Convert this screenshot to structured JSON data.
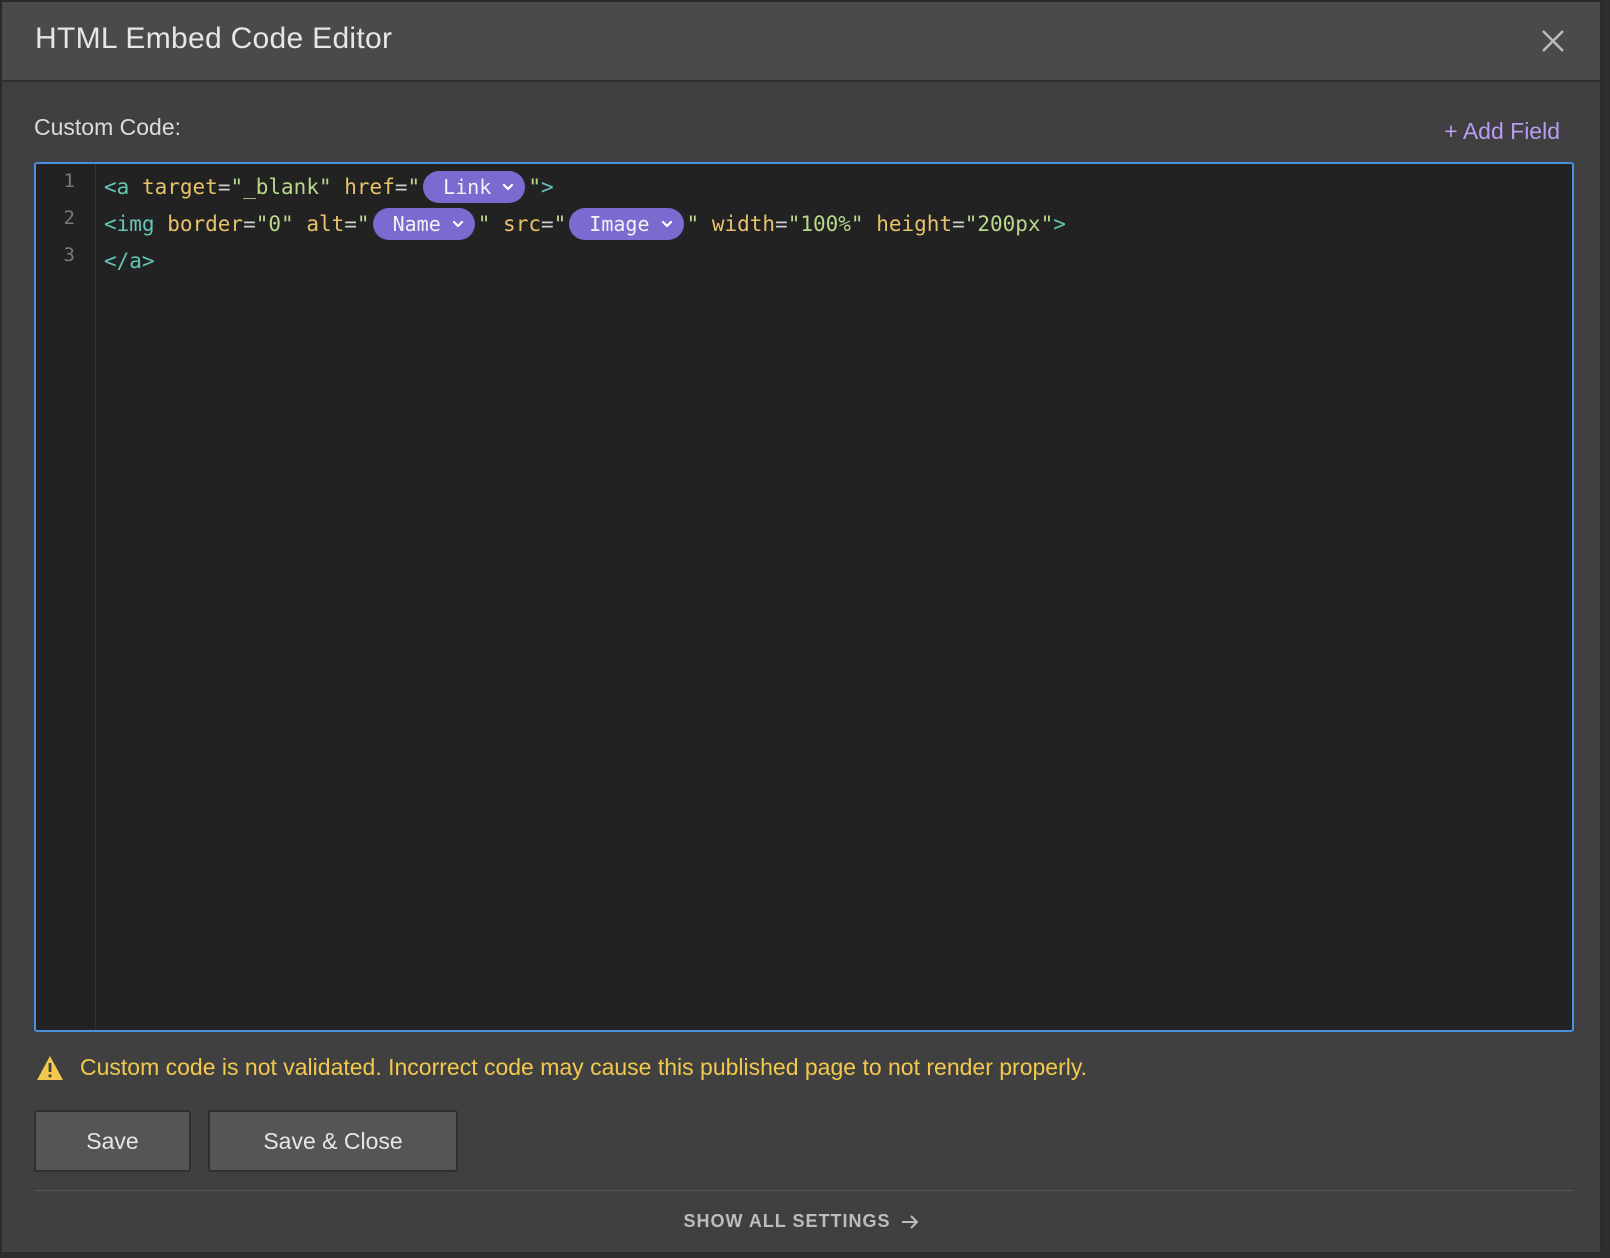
{
  "dialog": {
    "title": "HTML Embed Code Editor",
    "close_icon": "close-icon"
  },
  "custom_code": {
    "label": "Custom Code:",
    "add_field_label": "+ Add Field"
  },
  "editor": {
    "line_numbers": [
      "1",
      "2",
      "3"
    ],
    "line1": {
      "t1": "<a",
      "a1": " target",
      "p1": "=",
      "s1": "\"_blank\"",
      "a2": " href",
      "p2": "=",
      "s2": "\"",
      "chip_link": "Link",
      "s3": "\"",
      "t2": ">"
    },
    "line2": {
      "t1": "<img",
      "a1": " border",
      "p1": "=",
      "s1": "\"0\"",
      "a2": " alt",
      "p2": "=",
      "s2": "\"",
      "chip_name": "Name",
      "s3": "\"",
      "a3": " src",
      "p3": "=",
      "s4": "\"",
      "chip_image": "Image",
      "s5": "\"",
      "a4": " width",
      "p4": "=",
      "s6": "\"100%\"",
      "a5": " height",
      "p5": "=",
      "s7": "\"200px\"",
      "t2": ">"
    },
    "line3": {
      "t1": "</a>"
    }
  },
  "warning": {
    "icon": "warning-icon",
    "text": "Custom code is not validated. Incorrect code may cause this published page to not render properly."
  },
  "buttons": {
    "save": "Save",
    "save_close": "Save & Close"
  },
  "footer": {
    "show_all": "SHOW ALL SETTINGS",
    "arrow_icon": "arrow-right-icon"
  },
  "colors": {
    "accent_purple": "#7b6bd1",
    "link_purple": "#b99cf3",
    "focus_blue": "#4a90e2",
    "warning_yellow": "#f2c94c"
  }
}
